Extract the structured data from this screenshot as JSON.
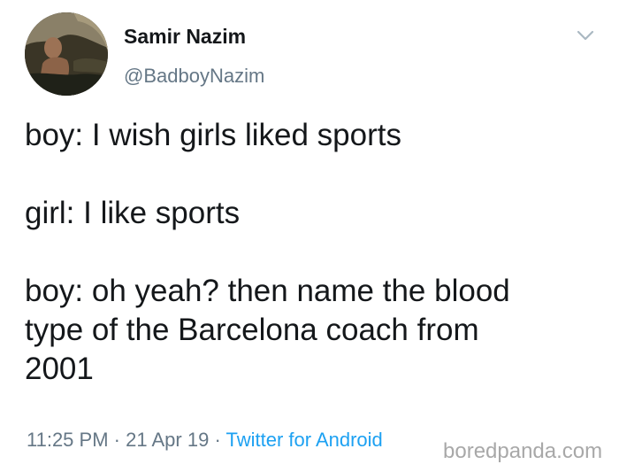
{
  "tweet": {
    "author_name": "Samir Nazim",
    "author_handle": "@BadboyNazim",
    "paragraphs": [
      "boy: I wish girls liked sports",
      "girl: I like sports",
      "boy: oh yeah? then name the blood\ntype of the Barcelona coach from\n2001"
    ],
    "time": "11:25 PM",
    "separator": "·",
    "date": "21 Apr 19",
    "source": "Twitter for Android"
  },
  "watermark": "boredpanda.com",
  "icons": {
    "menu": "chevron-down-icon",
    "avatar": "avatar"
  },
  "colors": {
    "text": "#14171a",
    "secondary": "#657786",
    "link": "#1da1f2"
  }
}
